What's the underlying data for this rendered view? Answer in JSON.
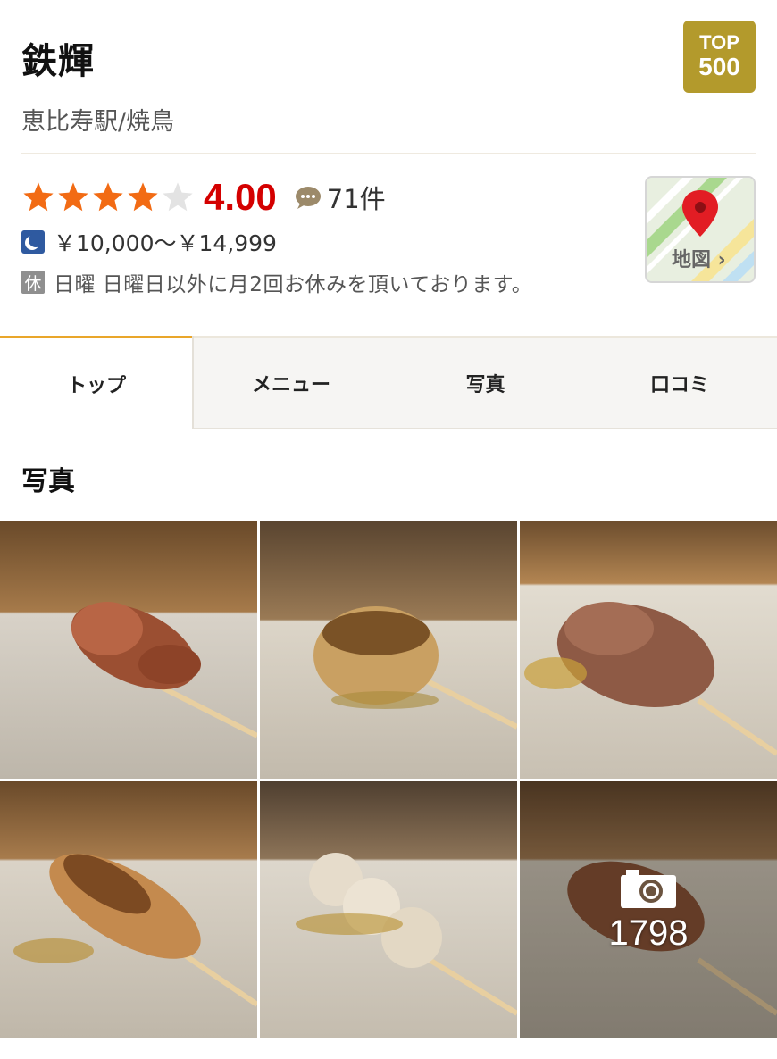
{
  "restaurant": {
    "name": "鉄輝",
    "station_genre": "恵比寿駅/焼鳥",
    "badge": {
      "line1": "TOP",
      "line2": "500",
      "color": "#b39a2c"
    },
    "rating": {
      "score": "4.00",
      "stars": 4,
      "max_stars": 5,
      "review_count": "71件"
    },
    "price": "￥10,000～￥14,999",
    "holiday": {
      "icon_label": "休",
      "text": "日曜 日曜日以外に月2回お休みを頂いております。"
    },
    "map_button": {
      "label": "地図 ›"
    }
  },
  "tabs": [
    {
      "label": "トップ",
      "active": true
    },
    {
      "label": "メニュー",
      "active": false
    },
    {
      "label": "写真",
      "active": false
    },
    {
      "label": "口コミ",
      "active": false
    }
  ],
  "photos_section": {
    "title": "写真",
    "photo_count": "1798",
    "photos": [
      "yakitori-1",
      "yakitori-2",
      "yakitori-3",
      "yakitori-4",
      "yakitori-5",
      "yakitori-6"
    ]
  },
  "colors": {
    "star": "#f26b14",
    "star_empty": "#e3e3e3",
    "score": "#d40000",
    "active_tab_accent": "#e9a62a"
  }
}
